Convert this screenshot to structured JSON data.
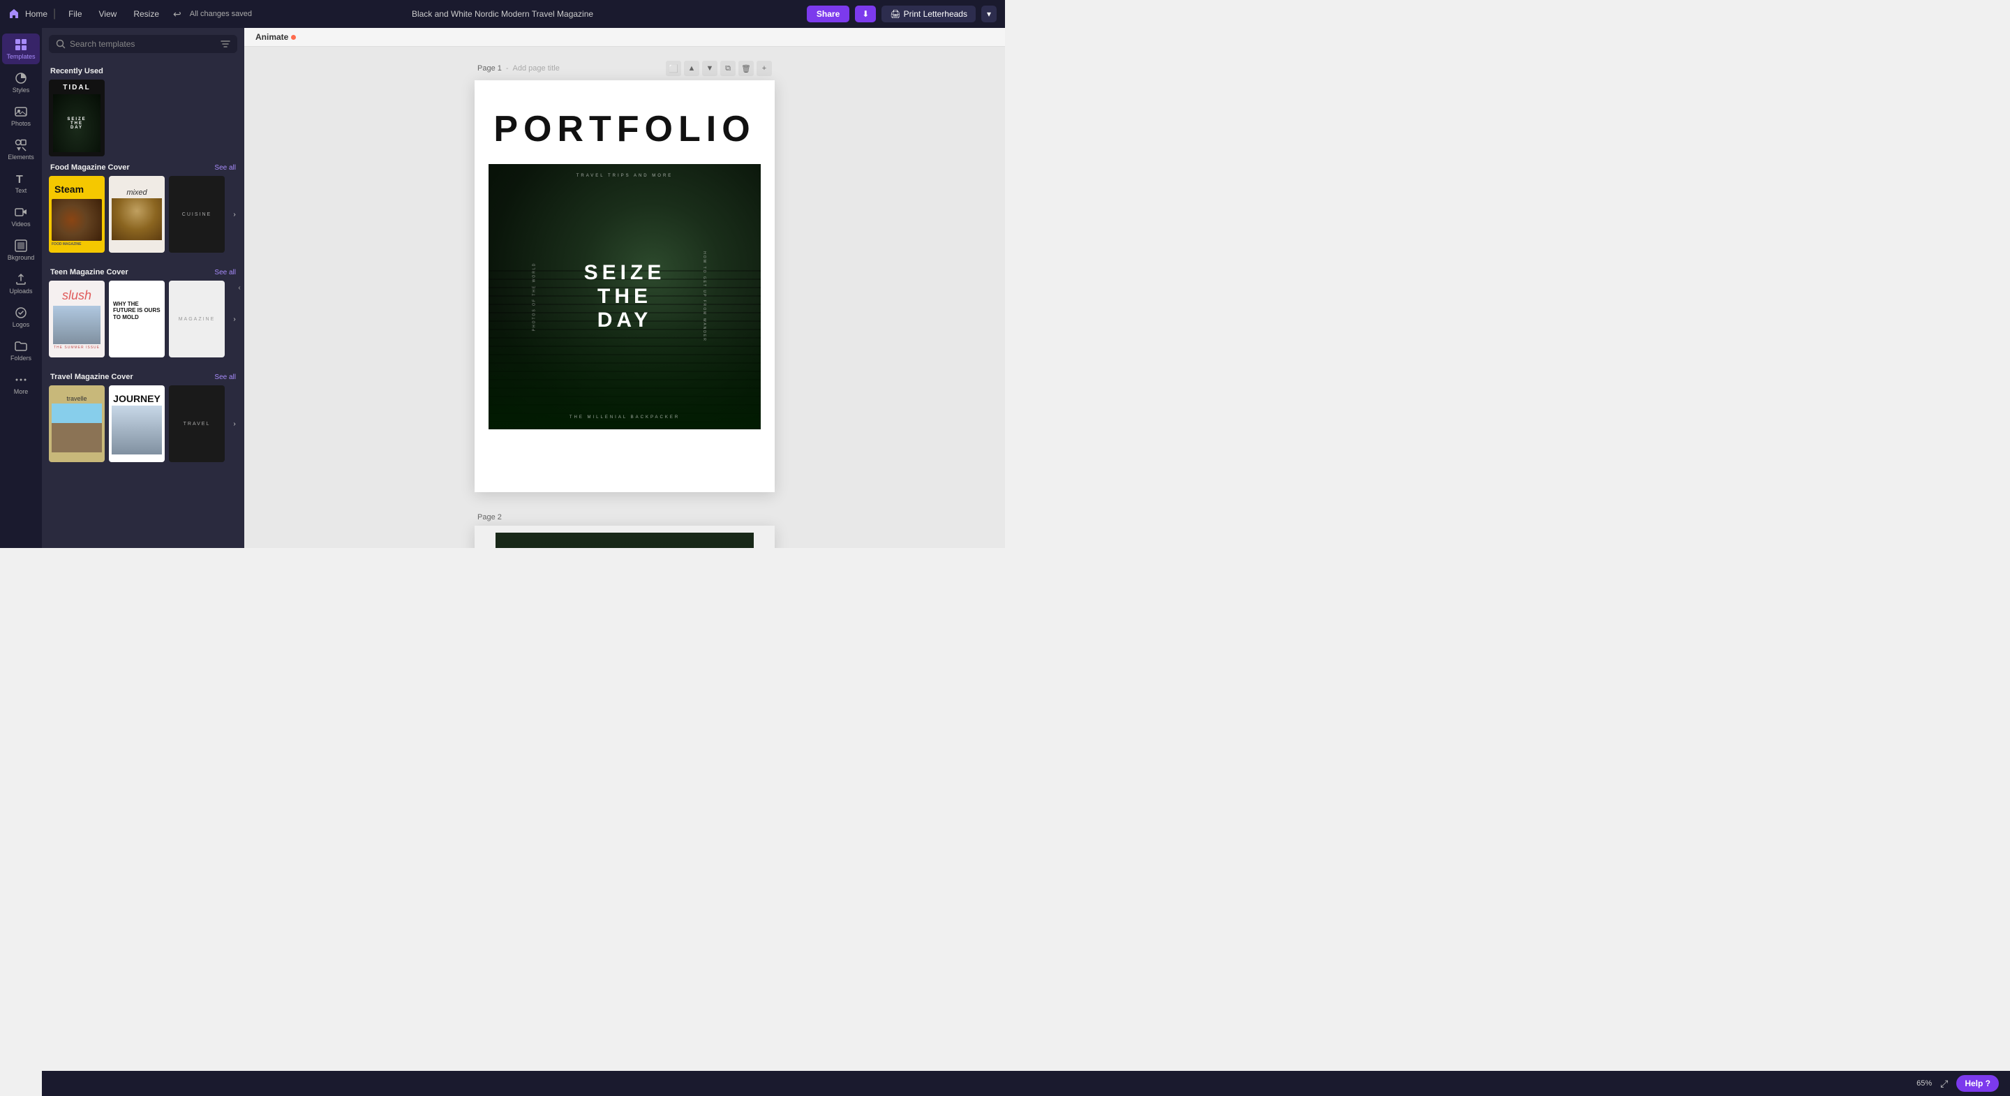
{
  "topbar": {
    "home_label": "Home",
    "file_label": "File",
    "view_label": "View",
    "resize_label": "Resize",
    "saved_label": "All changes saved",
    "title": "Black and White Nordic Modern Travel Magazine",
    "share_label": "Share",
    "download_icon": "⬇",
    "print_label": "Print Letterheads",
    "expand_icon": "▾"
  },
  "sidebar": {
    "items": [
      {
        "id": "templates",
        "label": "Templates",
        "icon": "grid"
      },
      {
        "id": "styles",
        "label": "Styles",
        "icon": "style"
      },
      {
        "id": "photos",
        "label": "Photos",
        "icon": "photo"
      },
      {
        "id": "elements",
        "label": "Elements",
        "icon": "elements"
      },
      {
        "id": "text",
        "label": "Text",
        "icon": "text"
      },
      {
        "id": "videos",
        "label": "Videos",
        "icon": "video"
      },
      {
        "id": "background",
        "label": "Bkground",
        "icon": "bg"
      },
      {
        "id": "uploads",
        "label": "Uploads",
        "icon": "upload"
      },
      {
        "id": "logos",
        "label": "Logos",
        "icon": "logos"
      },
      {
        "id": "folders",
        "label": "Folders",
        "icon": "folder"
      },
      {
        "id": "more",
        "label": "More",
        "icon": "more"
      }
    ]
  },
  "templates_panel": {
    "search_placeholder": "Search templates",
    "recently_used_label": "Recently Used",
    "sections": [
      {
        "id": "food",
        "title": "Food Magazine Cover",
        "see_all": "See all"
      },
      {
        "id": "teen",
        "title": "Teen Magazine Cover",
        "see_all": "See all"
      },
      {
        "id": "travel",
        "title": "Travel Magazine Cover",
        "see_all": "See all"
      }
    ]
  },
  "canvas": {
    "animate_label": "Animate",
    "page1_label": "Page 1",
    "page1_placeholder": "Add page title",
    "page2_label": "Page 2",
    "portfolio_title": "PORTFOLIO",
    "travel_subtitle": "TRAVEL TRIPS AND MORE",
    "seize_line1": "SEIZE",
    "seize_line2": "THE",
    "seize_line3": "DAY",
    "side_left": "PHOTOS OF THE WORLD",
    "side_right": "HOW TO GET UP FROM WANDER",
    "bottom_text": "THE MILLENIAL BACKPACKER"
  },
  "bottom": {
    "zoom_level": "65%",
    "help_label": "Help ?"
  }
}
